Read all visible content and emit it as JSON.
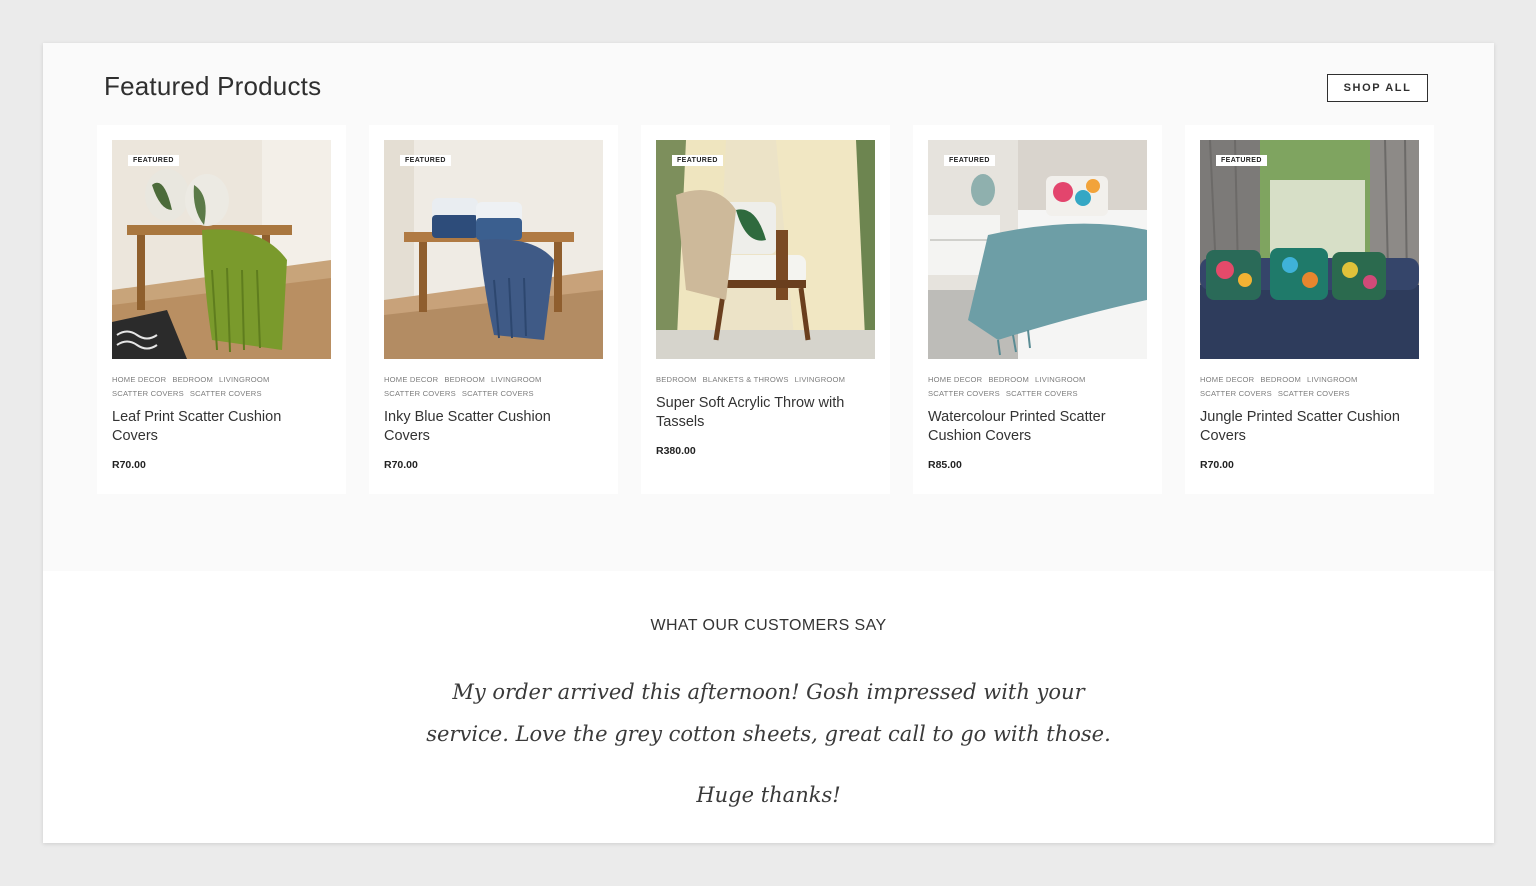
{
  "section": {
    "title": "Featured Products",
    "shop_all_label": "SHOP ALL"
  },
  "products": [
    {
      "badge": "FEATURED",
      "tags": [
        "HOME DECOR",
        "BEDROOM",
        "LIVINGROOM",
        "SCATTER COVERS",
        "SCATTER COVERS"
      ],
      "name": "Leaf Print Scatter Cushion Covers",
      "price": "R70.00"
    },
    {
      "badge": "FEATURED",
      "tags": [
        "HOME DECOR",
        "BEDROOM",
        "LIVINGROOM",
        "SCATTER COVERS",
        "SCATTER COVERS"
      ],
      "name": "Inky Blue Scatter Cushion Covers",
      "price": "R70.00"
    },
    {
      "badge": "FEATURED",
      "tags": [
        "BEDROOM",
        "BLANKETS & THROWS",
        "LIVINGROOM"
      ],
      "name": "Super Soft Acrylic Throw with Tassels",
      "price": "R380.00"
    },
    {
      "badge": "FEATURED",
      "tags": [
        "HOME DECOR",
        "BEDROOM",
        "LIVINGROOM",
        "SCATTER COVERS",
        "SCATTER COVERS"
      ],
      "name": "Watercolour Printed Scatter Cushion Covers",
      "price": "R85.00"
    },
    {
      "badge": "FEATURED",
      "tags": [
        "HOME DECOR",
        "BEDROOM",
        "LIVINGROOM",
        "SCATTER COVERS",
        "SCATTER COVERS"
      ],
      "name": "Jungle Printed Scatter Cushion Covers",
      "price": "R70.00"
    }
  ],
  "testimonial": {
    "heading": "WHAT OUR CUSTOMERS SAY",
    "quote_line1": "My order arrived this afternoon! Gosh impressed with your",
    "quote_line2": "service. Love the grey cotton sheets, great call to go with those.",
    "quote_line3": "Huge thanks!"
  }
}
